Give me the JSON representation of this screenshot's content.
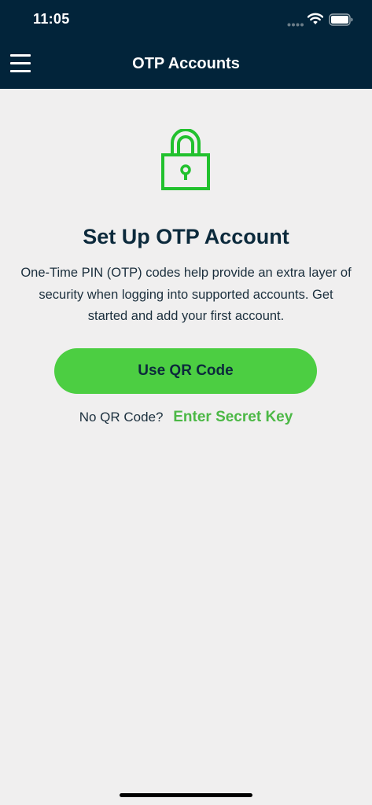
{
  "status_bar": {
    "time": "11:05"
  },
  "header": {
    "title": "OTP Accounts",
    "menu_icon": "hamburger-menu-icon"
  },
  "main": {
    "icon": "lock-icon",
    "heading": "Set Up OTP Account",
    "description": "One-Time PIN (OTP) codes help provide an extra layer of security when logging into supported accounts. Get started and add your first account.",
    "primary_button_label": "Use QR Code",
    "secret_prompt": "No QR Code?",
    "secret_link_label": "Enter Secret Key"
  },
  "colors": {
    "header_bg": "#02243a",
    "accent_green": "#4cce42",
    "link_green": "#4cb846",
    "lock_green": "#22c12e",
    "background": "#f0efef",
    "text_dark": "#0c2a3c"
  }
}
